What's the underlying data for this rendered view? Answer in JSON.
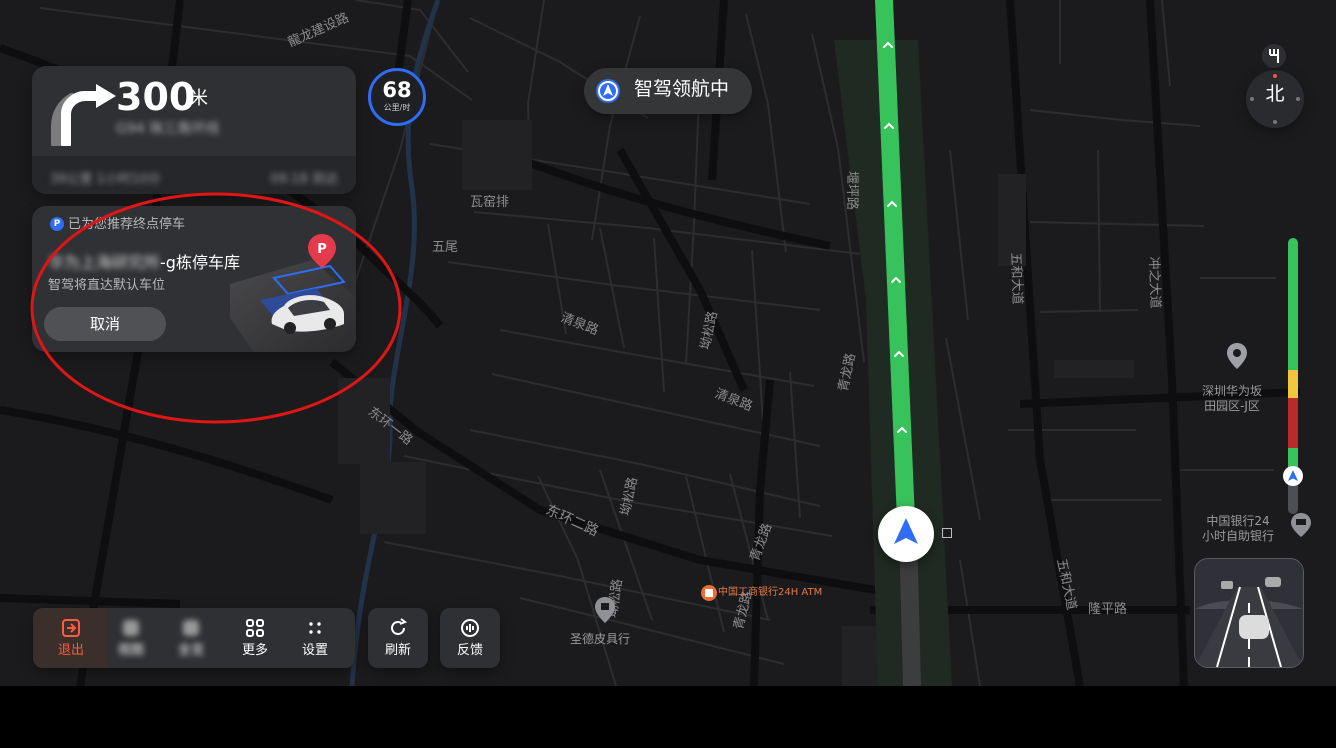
{
  "navigation": {
    "distance": "300",
    "distance_unit": "米",
    "road_name": "G94 珠三角环线",
    "footer_left": "39公里 1小时10分",
    "footer_right": "09:18 到达"
  },
  "speed": {
    "value": "68",
    "unit": "公里/时"
  },
  "status": {
    "label": "智驾领航中"
  },
  "parking": {
    "header": "已为您推荐终点停车",
    "badge_letter": "P",
    "lot_prefix": "华为上海研究所",
    "lot_suffix": "-g栋停车库",
    "subtitle": "智驾将直达默认车位",
    "cancel_label": "取消"
  },
  "compass": {
    "label": "北"
  },
  "controls": [
    {
      "label": "退出"
    },
    {
      "label": "视图"
    },
    {
      "label": "全览"
    },
    {
      "label": "更多"
    },
    {
      "label": "设置"
    },
    {
      "label": "刷新"
    },
    {
      "label": "反馈"
    }
  ],
  "map_labels": {
    "road_1": "龍龙建设路",
    "road_2": "瓦窑排",
    "road_3": "五尾",
    "road_4": "清泉路",
    "road_5": "清泉路",
    "road_6": "东环一路",
    "road_7": "东环二路",
    "road_8": "坳松路",
    "road_9": "坳松路",
    "road_10": "青龙路",
    "road_11": "青龙路",
    "road_12": "堰坪路",
    "road_13": "五和大道",
    "road_14": "五和大道",
    "road_15": "冲之大道",
    "road_16": "隆平路",
    "road_17": "坳松路",
    "road_18": "青龙路"
  },
  "pois": {
    "huawei": "深圳华为坂\n田园区-J区",
    "bank": "中国银行24\n小时自助银行",
    "atm": "中国工商银行24H ATM",
    "shop": "圣德皮具行"
  },
  "colors": {
    "route_green": "#38c25b",
    "accent_blue": "#2f6df4",
    "exit_red": "#ff5b3f",
    "traffic_yellow": "#f0c73c",
    "traffic_red": "#b92a2a"
  }
}
